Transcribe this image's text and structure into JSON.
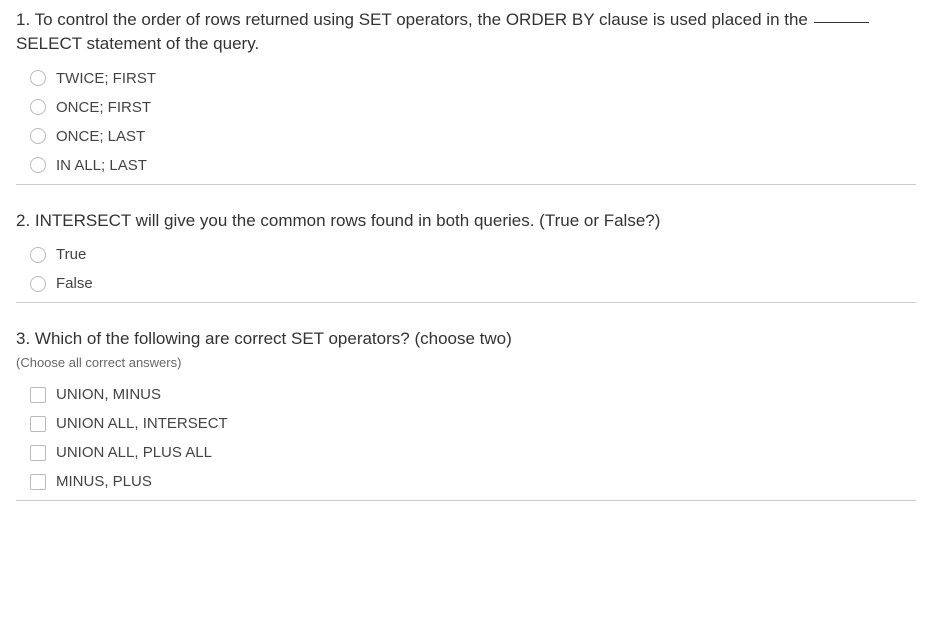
{
  "questions": [
    {
      "number": "1.",
      "text_before": "To control the order of rows returned using SET operators, the ORDER BY clause is used placed in the ",
      "text_after": " SELECT statement of the query.",
      "has_blank": true,
      "type": "radio",
      "sub_instruction": null,
      "options": [
        "TWICE; FIRST",
        "ONCE; FIRST",
        "ONCE; LAST",
        "IN ALL; LAST"
      ]
    },
    {
      "number": "2.",
      "text_before": "INTERSECT will give you the common rows found in both queries. (True or False?)",
      "text_after": "",
      "has_blank": false,
      "type": "radio",
      "sub_instruction": null,
      "options": [
        "True",
        "False"
      ]
    },
    {
      "number": "3.",
      "text_before": "Which of the following are correct SET operators? (choose two)",
      "text_after": "",
      "has_blank": false,
      "type": "checkbox",
      "sub_instruction": "(Choose all correct answers)",
      "options": [
        "UNION, MINUS",
        "UNION ALL, INTERSECT",
        "UNION ALL, PLUS ALL",
        "MINUS, PLUS"
      ]
    }
  ]
}
